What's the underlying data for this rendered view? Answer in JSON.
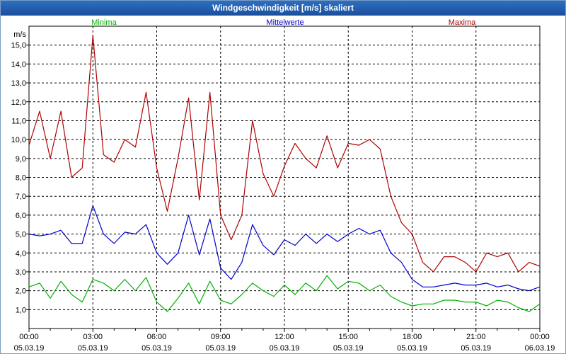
{
  "window": {
    "title": "Windgeschwindigkeit [m/s] skaliert"
  },
  "colors": {
    "minima": "#00b000",
    "mittelwerte": "#0000c8",
    "maxima": "#b00000",
    "titlebar": "#1f5aa8"
  },
  "chart_data": {
    "type": "line",
    "title": "Windgeschwindigkeit [m/s] skaliert",
    "ylabel": "m/s",
    "xlabel": "",
    "ylim": [
      0,
      16.0
    ],
    "xlim_hours": [
      0,
      24
    ],
    "grid": true,
    "legend": [
      "Minima",
      "Mittelwerte",
      "Maxima"
    ],
    "yticks": [
      "1,0",
      "2,0",
      "3,0",
      "4,0",
      "5,0",
      "6,0",
      "7,0",
      "8,0",
      "9,0",
      "10,0",
      "11,0",
      "12,0",
      "13,0",
      "14,0",
      "15,0"
    ],
    "xticks": [
      {
        "time": "00:00",
        "date": "05.03.19"
      },
      {
        "time": "03:00",
        "date": "05.03.19"
      },
      {
        "time": "06:00",
        "date": "05.03.19"
      },
      {
        "time": "09:00",
        "date": "05.03.19"
      },
      {
        "time": "12:00",
        "date": "05.03.19"
      },
      {
        "time": "15:00",
        "date": "05.03.19"
      },
      {
        "time": "18:00",
        "date": "05.03.19"
      },
      {
        "time": "21:00",
        "date": "05.03.19"
      },
      {
        "time": "00:00",
        "date": "06.03.19"
      }
    ],
    "x_hours": [
      0,
      0.5,
      1,
      1.5,
      2,
      2.5,
      3,
      3.5,
      4,
      4.5,
      5,
      5.5,
      6,
      6.5,
      7,
      7.5,
      8,
      8.5,
      9,
      9.5,
      10,
      10.5,
      11,
      11.5,
      12,
      12.5,
      13,
      13.5,
      14,
      14.5,
      15,
      15.5,
      16,
      16.5,
      17,
      17.5,
      18,
      18.5,
      19,
      19.5,
      20,
      20.5,
      21,
      21.5,
      22,
      22.5,
      23,
      23.5,
      24
    ],
    "series": [
      {
        "name": "Maxima",
        "values": [
          9.7,
          11.5,
          9.0,
          11.5,
          8.0,
          8.5,
          15.5,
          9.2,
          8.8,
          10.0,
          9.6,
          12.5,
          8.5,
          6.2,
          9.0,
          12.2,
          6.8,
          12.5,
          6.0,
          4.7,
          6.0,
          11.0,
          8.2,
          7.0,
          8.6,
          9.8,
          9.0,
          8.5,
          10.2,
          8.5,
          9.8,
          9.7,
          10.0,
          9.5,
          7.0,
          5.6,
          5.0,
          3.5,
          3.0,
          3.8,
          3.8,
          3.5,
          3.0,
          4.0,
          3.8,
          4.0,
          3.0,
          3.5,
          3.3
        ]
      },
      {
        "name": "Mittelwerte",
        "values": [
          5.0,
          4.9,
          5.0,
          5.2,
          4.5,
          4.5,
          6.5,
          5.0,
          4.5,
          5.1,
          5.0,
          5.5,
          4.0,
          3.4,
          4.0,
          6.0,
          3.9,
          5.8,
          3.2,
          2.6,
          3.5,
          5.5,
          4.4,
          3.9,
          4.7,
          4.4,
          5.0,
          4.5,
          5.0,
          4.6,
          5.0,
          5.3,
          5.0,
          5.2,
          4.0,
          3.5,
          2.6,
          2.2,
          2.2,
          2.3,
          2.4,
          2.3,
          2.3,
          2.4,
          2.2,
          2.3,
          2.1,
          2.0,
          2.2
        ]
      },
      {
        "name": "Minima",
        "values": [
          2.2,
          2.4,
          1.6,
          2.5,
          1.8,
          1.4,
          2.6,
          2.4,
          2.0,
          2.6,
          2.0,
          2.7,
          1.4,
          0.9,
          1.6,
          2.4,
          1.3,
          2.5,
          1.5,
          1.3,
          1.8,
          2.4,
          2.0,
          1.7,
          2.3,
          1.8,
          2.4,
          2.0,
          2.8,
          2.1,
          2.5,
          2.4,
          2.0,
          2.3,
          1.7,
          1.4,
          1.2,
          1.3,
          1.3,
          1.5,
          1.5,
          1.4,
          1.4,
          1.2,
          1.5,
          1.4,
          1.1,
          0.9,
          1.3
        ]
      }
    ]
  }
}
